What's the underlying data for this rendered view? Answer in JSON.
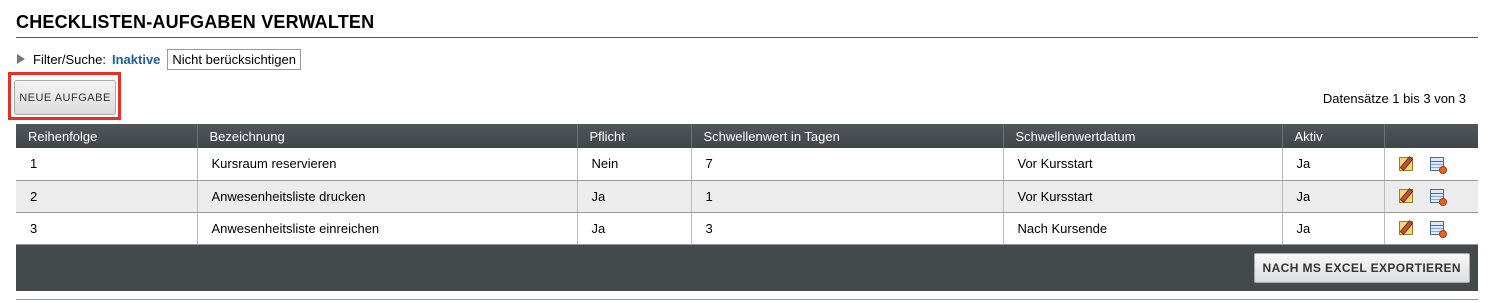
{
  "page": {
    "title": "CHECKLISTEN-AUFGABEN VERWALTEN"
  },
  "filter": {
    "label": "Filter/Suche:",
    "value": "Inaktive",
    "option": "Nicht berücksichtigen",
    "toggle_icon": "triangle-right-icon"
  },
  "toolbar": {
    "new_task_label": "NEUE AUFGABE",
    "highlight_color": "#e63025"
  },
  "records": {
    "summary": "Datensätze 1 bis 3 von 3"
  },
  "table": {
    "headers": [
      "Reihenfolge",
      "Bezeichnung",
      "Pflicht",
      "Schwellenwert in Tagen",
      "Schwellenwertdatum",
      "Aktiv",
      ""
    ],
    "rows": [
      {
        "order": "1",
        "name": "Kursraum reservieren",
        "mandatory": "Nein",
        "threshold_days": "7",
        "threshold_date": "Vor Kursstart",
        "active": "Ja"
      },
      {
        "order": "2",
        "name": "Anwesenheitsliste drucken",
        "mandatory": "Ja",
        "threshold_days": "1",
        "threshold_date": "Vor Kursstart",
        "active": "Ja"
      },
      {
        "order": "3",
        "name": "Anwesenheitsliste einreichen",
        "mandatory": "Ja",
        "threshold_days": "3",
        "threshold_date": "Nach Kursende",
        "active": "Ja"
      }
    ],
    "row_actions": [
      "edit-icon",
      "delete-icon"
    ]
  },
  "footer": {
    "export_label": "NACH MS EXCEL EXPORTIEREN"
  },
  "colors": {
    "header_bg": "#44494c",
    "link_blue": "#1b5f9e",
    "alt_row": "#ececec"
  }
}
